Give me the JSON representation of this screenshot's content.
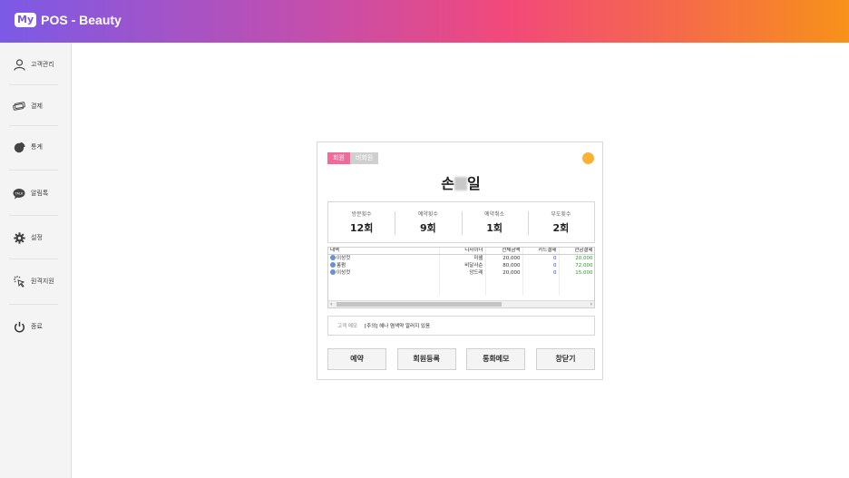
{
  "app": {
    "logo_badge": "My",
    "title": "POS - Beauty"
  },
  "sidebar": {
    "items": [
      {
        "label": "고객관리",
        "icon": "user-icon"
      },
      {
        "label": "결제",
        "icon": "card-icon"
      },
      {
        "label": "통계",
        "icon": "pie-chart-icon"
      },
      {
        "label": "알림톡",
        "icon": "talk-icon"
      },
      {
        "label": "설정",
        "icon": "gear-icon"
      },
      {
        "label": "원격지원",
        "icon": "remote-icon"
      },
      {
        "label": "종료",
        "icon": "power-icon"
      }
    ]
  },
  "dialog": {
    "tabs": [
      {
        "label": "회원"
      },
      {
        "label": "비회원"
      }
    ],
    "status_color": "#f9b233",
    "customer_name_start": "손",
    "customer_name_end": "일",
    "stats": [
      {
        "label": "방문횟수",
        "value": "12회"
      },
      {
        "label": "예약횟수",
        "value": "9회"
      },
      {
        "label": "예약취소",
        "value": "1회"
      },
      {
        "label": "부도횟수",
        "value": "2회"
      }
    ],
    "table": {
      "headers": [
        "내역",
        "디자이너",
        "전체금액",
        "카드결제",
        "현금결제"
      ],
      "rows": [
        {
          "item": "이성컷",
          "designer": "미쉘",
          "total": "20,000",
          "card": "0",
          "cash": "20,000"
        },
        {
          "item": "롱펌",
          "designer": "비달사순",
          "total": "80,000",
          "card": "0",
          "cash": "72,000"
        },
        {
          "item": "이성컷",
          "designer": "앙드레",
          "total": "20,000",
          "card": "0",
          "cash": "15,000"
        }
      ]
    },
    "memo": {
      "label": "고객 메모",
      "text": "[주의] 헤나 염색약 알러지 있음"
    },
    "buttons": {
      "reserve": "예약",
      "register": "회원등록",
      "call_memo": "통화메모",
      "close": "창닫기"
    }
  }
}
